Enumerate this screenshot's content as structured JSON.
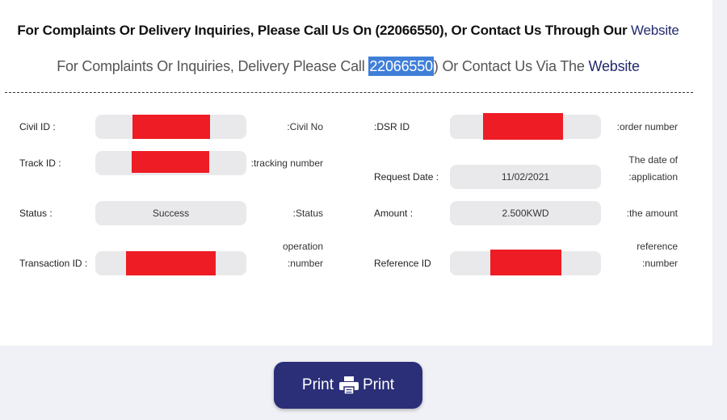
{
  "notice": {
    "english_prefix": "For Complaints Or Delivery Inquiries, Please Call Us On (22066550), Or Contact Us Through Our",
    "english_link": "Website",
    "translated_prefix": "For Complaints Or Inquiries, Delivery Please Call",
    "translated_phone": "22066550",
    "translated_middle": ") Or Contact Us Via The",
    "translated_link": "Website"
  },
  "fields": {
    "civil_id": {
      "label": "Civil ID :",
      "translation": ":Civil No"
    },
    "dsr_id": {
      "label": ":DSR ID",
      "translation": ":order number"
    },
    "track_id": {
      "label": "Track ID :",
      "translation": ":tracking number"
    },
    "request_date": {
      "label": "Request Date :",
      "value": "11/02/2021",
      "translation_line1": "The date of",
      "translation_line2": ":application"
    },
    "status": {
      "label": "Status :",
      "value": "Success",
      "translation": ":Status"
    },
    "amount": {
      "label": "Amount :",
      "value": "2.500KWD",
      "translation": ":the amount"
    },
    "transaction_id": {
      "label": "Transaction ID :",
      "translation_line1": "operation",
      "translation_line2": ":number"
    },
    "reference_id": {
      "label": "Reference ID",
      "translation_line1": "reference",
      "translation_line2": ":number"
    }
  },
  "print_button": {
    "label_left": "Print",
    "label_right": "Print",
    "icon": "printer-icon"
  },
  "colors": {
    "redaction": "#ee1c24",
    "button": "#2b2f78",
    "link": "#232a6e",
    "highlight": "#3f7fd8"
  }
}
